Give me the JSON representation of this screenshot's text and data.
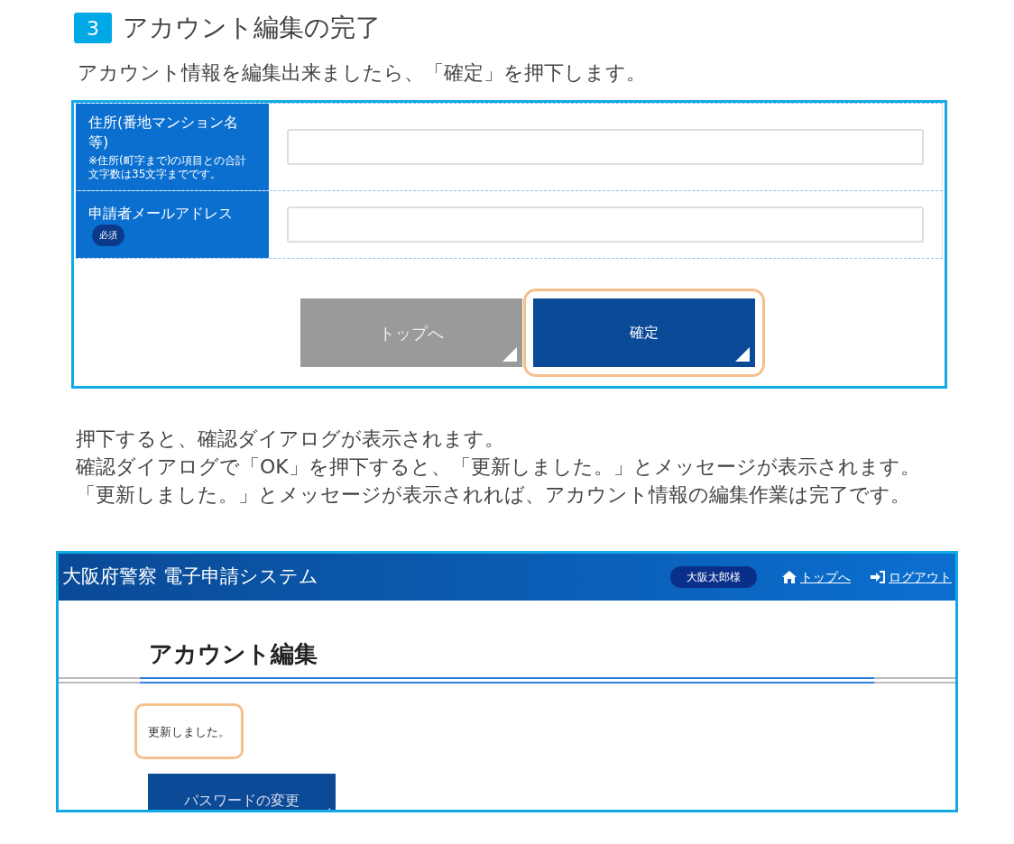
{
  "step": {
    "number": "3",
    "title": "アカウント編集の完了"
  },
  "intro": "アカウント情報を編集出来ましたら、「確定」を押下します。",
  "form_screenshot": {
    "fields": [
      {
        "label": "住所(番地マンション名等)",
        "note": "※住所(町字まで)の項目との合計文字数は35文字までです。"
      },
      {
        "label": "申請者メールアドレス",
        "badge": "必須"
      }
    ],
    "buttons": [
      {
        "label": "トップへ",
        "kind": "secondary",
        "highlighted": false
      },
      {
        "label": "確定",
        "kind": "primary",
        "highlighted": true
      }
    ]
  },
  "explanation": [
    "押下すると、確認ダイアログが表示されます。",
    "確認ダイアログで「OK」を押下すると、「更新しました。」とメッセージが表示されます。",
    "「更新しました。」とメッセージが表示されれば、アカウント情報の編集作業は完了です。"
  ],
  "result_screenshot": {
    "app_title": "大阪府警察 電子申請システム",
    "user": "大阪太郎様",
    "links": [
      {
        "label": "トップへ",
        "kind": "home"
      },
      {
        "label": "ログアウト",
        "kind": "logout"
      }
    ],
    "page_title": "アカウント編集",
    "message": {
      "text": "更新しました。",
      "highlighted": true
    },
    "button": "パスワードの変更"
  }
}
